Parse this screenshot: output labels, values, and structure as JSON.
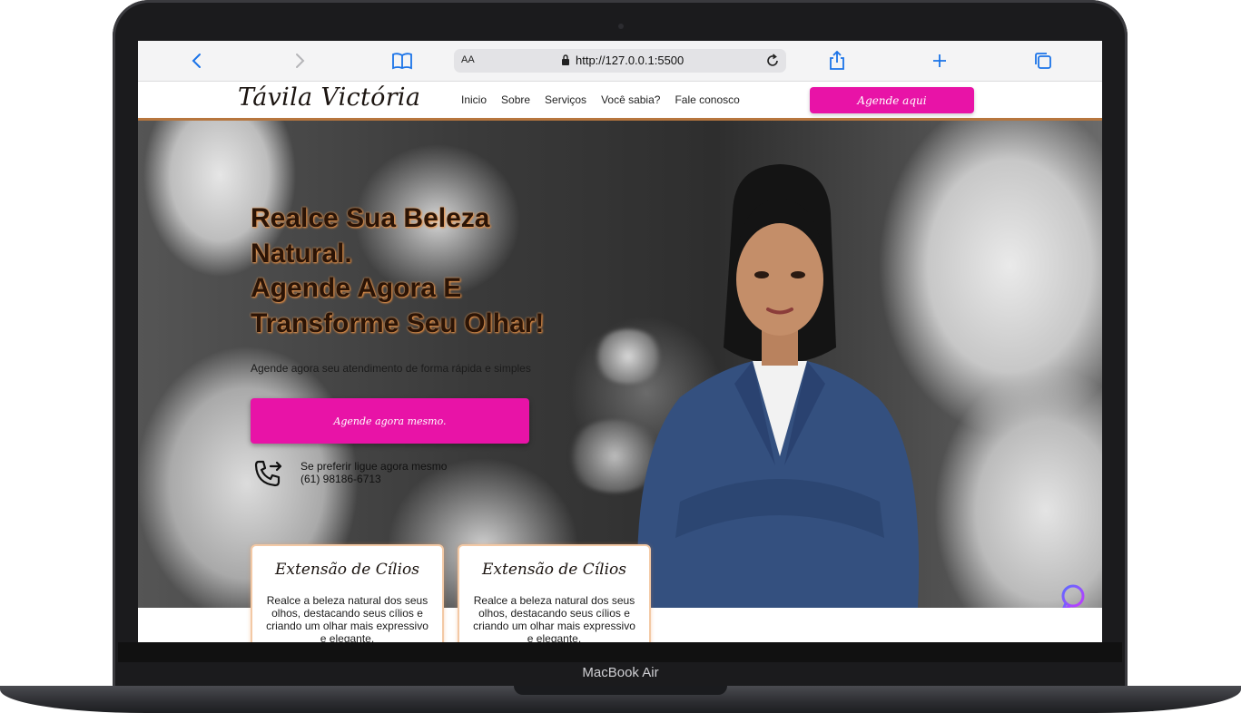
{
  "device": {
    "model_label": "MacBook Air"
  },
  "browser": {
    "text_size_label": "AA",
    "url": "http://127.0.0.1:5500",
    "icons": [
      "back-icon",
      "forward-icon",
      "book-icon",
      "lock-icon",
      "reload-icon",
      "share-icon",
      "plus-icon",
      "tabs-icon"
    ]
  },
  "site": {
    "logo": "Távila Victória",
    "nav": [
      "Inicio",
      "Sobre",
      "Serviços",
      "Você sabia?",
      "Fale conosco"
    ],
    "nav_cta": "Agende aqui",
    "hero": {
      "title_lines": [
        "Realce Sua Beleza",
        "Natural.",
        "Agende Agora E",
        "Transforme Seu Olhar!"
      ],
      "subtitle": "Agende agora seu atendimento de forma rápida e simples",
      "cta": "Agende agora mesmo.",
      "phone_prompt": "Se preferir ligue agora mesmo",
      "phone_number": "(61) 98186-6713"
    },
    "cards": [
      {
        "title": "Extensão de Cílios",
        "text": "Realce a beleza natural dos seus olhos, destacando seus cílios e criando um olhar mais expressivo e elegante."
      },
      {
        "title": "Extensão de Cílios",
        "text": "Realce a beleza natural dos seus olhos, destacando seus cílios e criando um olhar mais expressivo e elegante."
      }
    ]
  },
  "colors": {
    "accent": "#e813a7",
    "brown": "#b7763e",
    "title": "#2b1406"
  }
}
